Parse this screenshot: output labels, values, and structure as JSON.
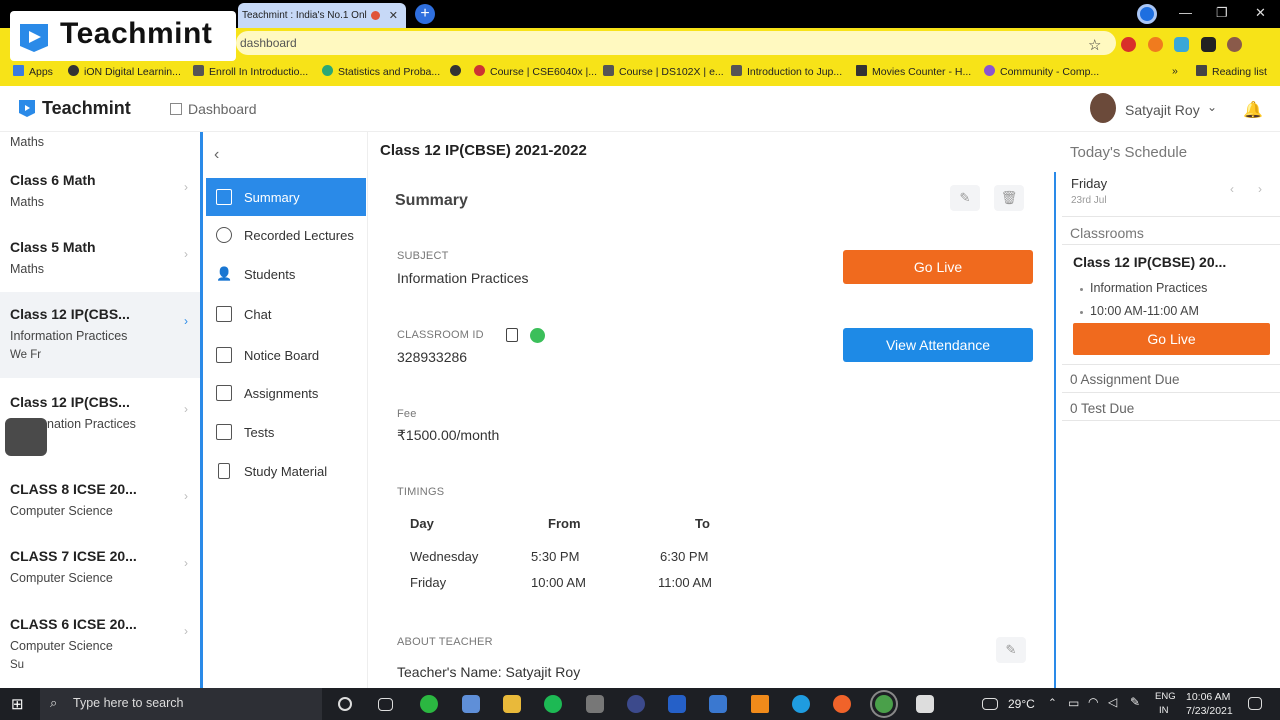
{
  "browser": {
    "tab_title": "Teachmint : India's No.1 Onl",
    "address": "dashboard",
    "bookmarks": [
      "Apps",
      "iON Digital Learnin...",
      "Enroll In Introductio...",
      "Statistics and Proba...",
      "Course | CSE6040x |...",
      "Course | DS102X | e...",
      "Introduction to Jup...",
      "Movies Counter - H...",
      "Community - Comp..."
    ],
    "more": "»",
    "reading_list": "Reading list"
  },
  "overlay_logo": "Teachmint",
  "header": {
    "brand": "Teachmint",
    "dashboard": "Dashboard",
    "user": "Satyajit Roy"
  },
  "classes": [
    {
      "title": "",
      "subject": "Maths"
    },
    {
      "title": "Class 6 Math",
      "subject": "Maths"
    },
    {
      "title": "Class 5 Math",
      "subject": "Maths"
    },
    {
      "title": "Class 12 IP(CBS...",
      "subject": "Information Practices",
      "days": "We  Fr"
    },
    {
      "title": "Class 12 IP(CBS...",
      "subject": "nation Practices"
    },
    {
      "title": "CLASS 8 ICSE 20...",
      "subject": "Computer Science"
    },
    {
      "title": "CLASS 7 ICSE 20...",
      "subject": "Computer Science"
    },
    {
      "title": "CLASS 6 ICSE 20...",
      "subject": "Computer Science",
      "days": "Su"
    }
  ],
  "nav": [
    "Summary",
    "Recorded Lectures",
    "Students",
    "Chat",
    "Notice Board",
    "Assignments",
    "Tests",
    "Study Material"
  ],
  "main": {
    "class_title": "Class 12 IP(CBSE) 2021-2022",
    "summary_heading": "Summary",
    "subject_label": "SUBJECT",
    "subject_value": "Information Practices",
    "classroom_id_label": "CLASSROOM ID",
    "classroom_id_value": "328933286",
    "fee_label": "Fee",
    "fee_value": "₹1500.00/month",
    "timings_label": "TIMINGS",
    "timing_headers": {
      "day": "Day",
      "from": "From",
      "to": "To"
    },
    "timings": [
      {
        "day": "Wednesday",
        "from": "5:30 PM",
        "to": "6:30 PM"
      },
      {
        "day": "Friday",
        "from": "10:00 AM",
        "to": "11:00 AM"
      }
    ],
    "about_label": "ABOUT TEACHER",
    "teacher_name": "Teacher's Name: Satyajit Roy",
    "go_live": "Go Live",
    "view_attendance": "View Attendance"
  },
  "schedule": {
    "heading": "Today's Schedule",
    "day": "Friday",
    "date": "23rd Jul",
    "classrooms_label": "Classrooms",
    "class_title": "Class 12 IP(CBSE) 20...",
    "subject": "Information Practices",
    "time": "10:00 AM-11:00 AM",
    "go_live": "Go Live",
    "assignment_due": "0 Assignment Due",
    "test_due": "0 Test Due"
  },
  "taskbar": {
    "search_placeholder": "Type here to search",
    "temperature": "29°C",
    "lang": "ENG",
    "region": "IN",
    "time": "10:06 AM",
    "date": "7/23/2021"
  },
  "colors": {
    "accent": "#2a8ae8",
    "orange": "#f06a1e",
    "bookmark_bar": "#f7e318"
  }
}
